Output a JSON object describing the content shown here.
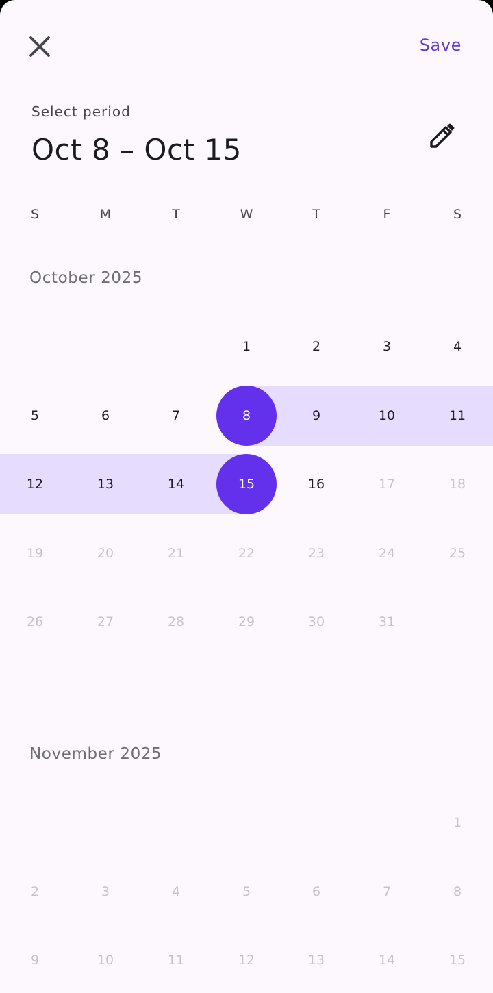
{
  "header": {
    "close_icon": "close-icon",
    "save_label": "Save",
    "subtitle": "Select period",
    "title": "Oct 8 – Oct 15",
    "edit_icon": "pencil-icon"
  },
  "weekdays": [
    "S",
    "M",
    "T",
    "W",
    "T",
    "F",
    "S"
  ],
  "colors": {
    "accent": "#6331eb",
    "range_fill": "#e6ddfe",
    "background": "#fdf8fd",
    "save_text": "#5f3ad8"
  },
  "months": [
    {
      "title": "October 2025",
      "first_weekday": 3,
      "days": 31,
      "range_start": 8,
      "range_end": 15,
      "disabled_from": 17
    },
    {
      "title": "November 2025",
      "first_weekday": 6,
      "days": 15,
      "range_start": null,
      "range_end": null,
      "disabled_from": 1
    }
  ]
}
